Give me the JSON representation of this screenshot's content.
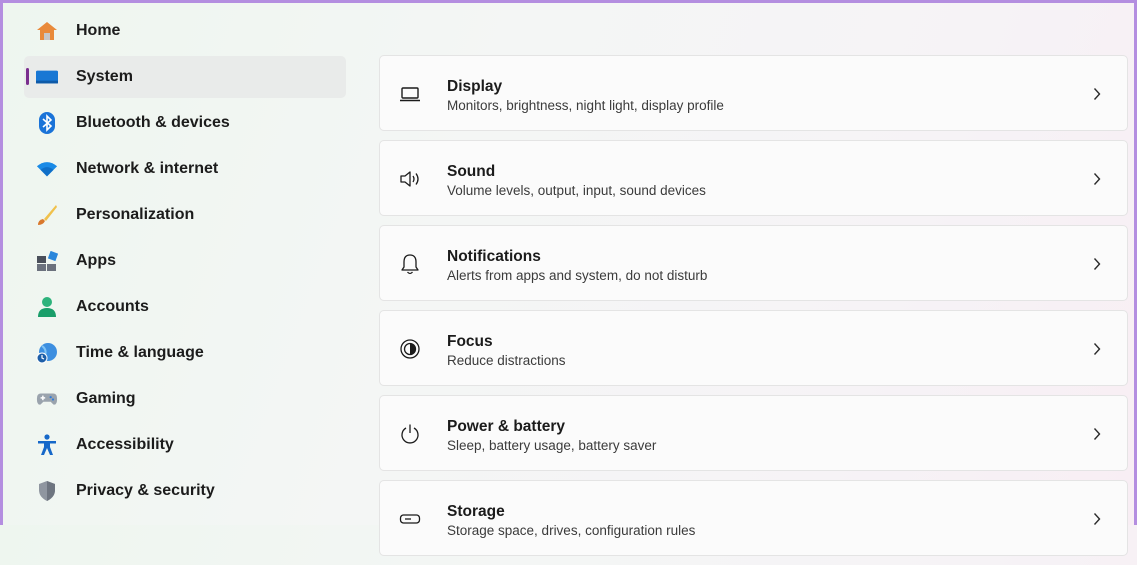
{
  "sidebar": {
    "items": [
      {
        "label": "Home",
        "icon": "home-icon"
      },
      {
        "label": "System",
        "icon": "system-icon",
        "active": true
      },
      {
        "label": "Bluetooth & devices",
        "icon": "bluetooth-icon"
      },
      {
        "label": "Network & internet",
        "icon": "wifi-icon"
      },
      {
        "label": "Personalization",
        "icon": "brush-icon"
      },
      {
        "label": "Apps",
        "icon": "apps-icon"
      },
      {
        "label": "Accounts",
        "icon": "person-icon"
      },
      {
        "label": "Time & language",
        "icon": "globe-clock-icon"
      },
      {
        "label": "Gaming",
        "icon": "gamepad-icon"
      },
      {
        "label": "Accessibility",
        "icon": "accessibility-icon"
      },
      {
        "label": "Privacy & security",
        "icon": "shield-icon"
      }
    ]
  },
  "main": {
    "cards": [
      {
        "title": "Display",
        "subtitle": "Monitors, brightness, night light, display profile",
        "icon": "monitor-icon"
      },
      {
        "title": "Sound",
        "subtitle": "Volume levels, output, input, sound devices",
        "icon": "speaker-icon"
      },
      {
        "title": "Notifications",
        "subtitle": "Alerts from apps and system, do not disturb",
        "icon": "bell-icon"
      },
      {
        "title": "Focus",
        "subtitle": "Reduce distractions",
        "icon": "focus-icon"
      },
      {
        "title": "Power & battery",
        "subtitle": "Sleep, battery usage, battery saver",
        "icon": "power-icon"
      },
      {
        "title": "Storage",
        "subtitle": "Storage space, drives, configuration rules",
        "icon": "storage-icon"
      }
    ]
  },
  "colors": {
    "accent": "#7a2e8e",
    "frame": "#b48ee0"
  }
}
